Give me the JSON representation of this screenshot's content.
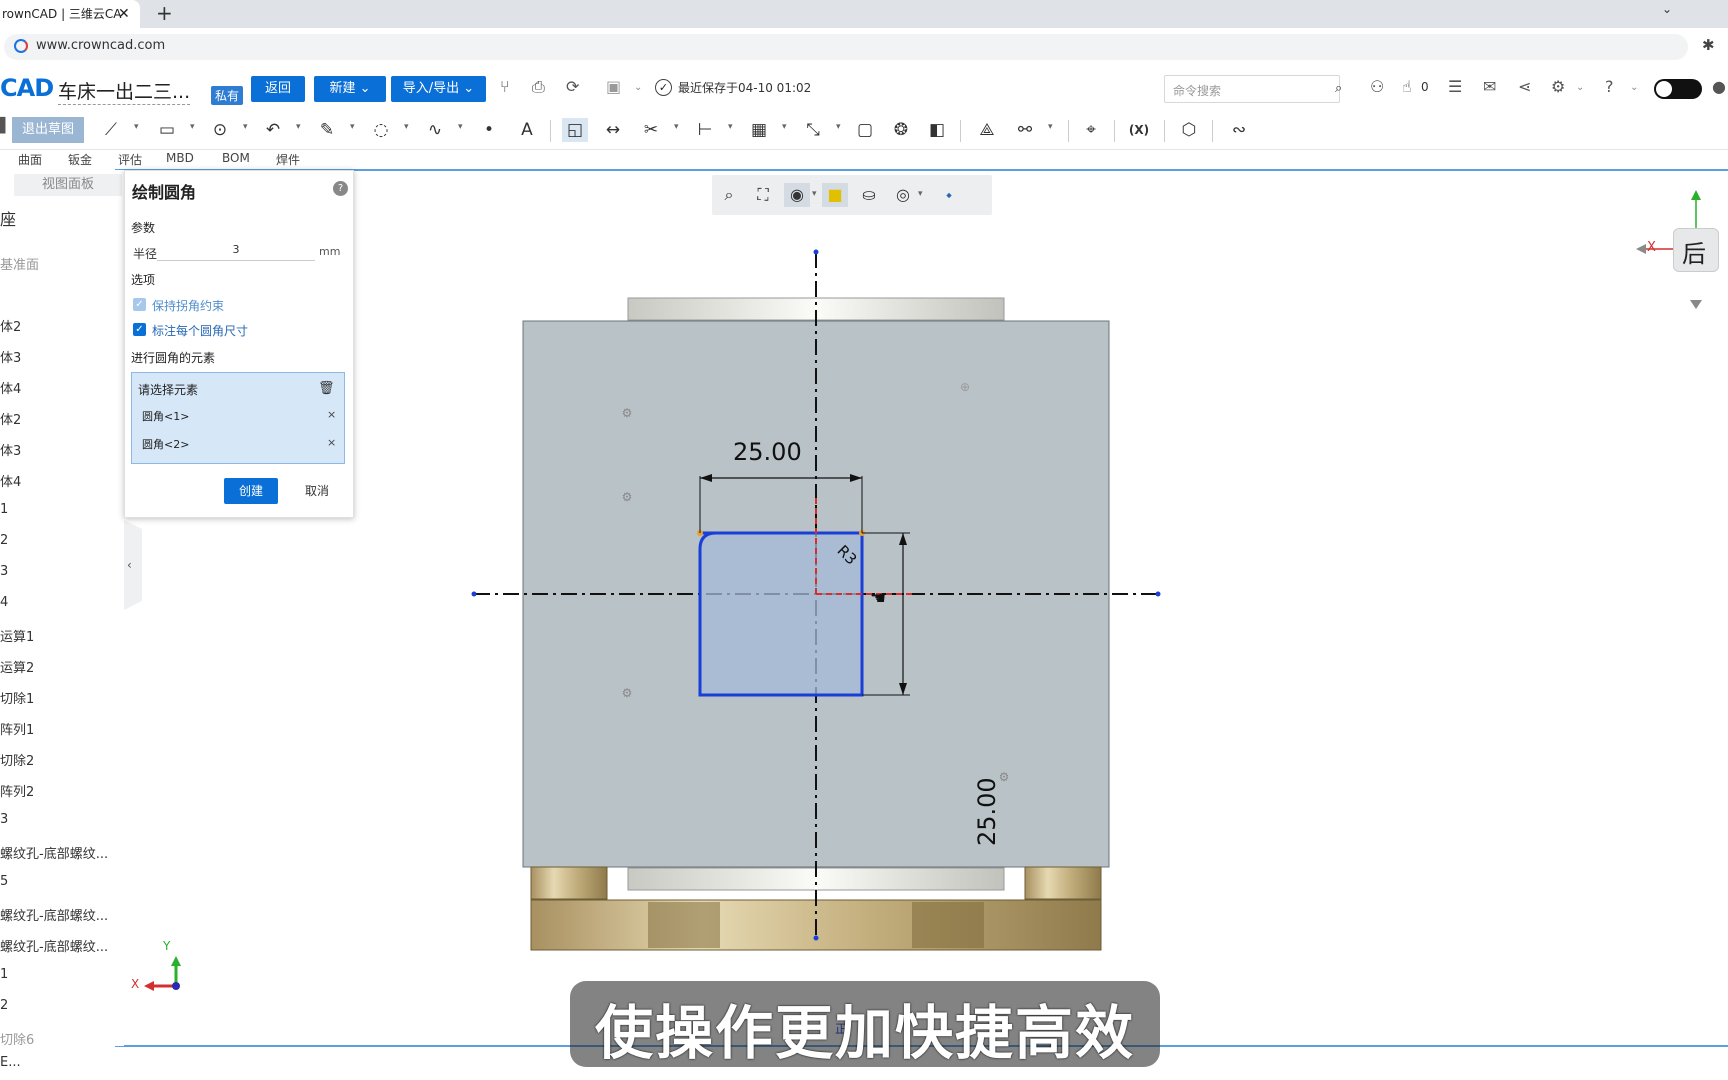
{
  "browser": {
    "tab_title": "rownCAD | 三维云CA",
    "tab_close": "✕",
    "new_tab": "+",
    "url": "www.crowncad.com"
  },
  "header": {
    "logo": "CAD",
    "doc_title": "车床一出二三...",
    "badge": "私有",
    "back_label": "返回",
    "new_label": "新建 ⌄",
    "io_label": "导入/导出 ⌄",
    "save_status": "最近保存于04-10 01:02",
    "search_placeholder": "命令搜索",
    "like_count": "0"
  },
  "toolbar": {
    "exit_sketch": "退出草图",
    "text_tool": "A",
    "fx_tool": "(X)"
  },
  "menu_tabs": [
    "曲面",
    "钣金",
    "评估",
    "MBD",
    "BOM",
    "焊件"
  ],
  "sidebar": {
    "view_panel": "视图面板",
    "items": [
      "座",
      "基准面",
      "体2",
      "体3",
      "体4",
      "体2",
      "体3",
      "体4",
      "1",
      "2",
      "3",
      "4",
      "运算1",
      "运算2",
      "切除1",
      "阵列1",
      "切除2",
      "阵列2",
      "3",
      "螺纹孔-底部螺纹...",
      "5",
      "螺纹孔-底部螺纹...",
      "螺纹孔-底部螺纹...",
      "1",
      "2",
      "切除6",
      "E..."
    ]
  },
  "fillet_panel": {
    "title": "绘制圆角",
    "help": "?",
    "params_header": "参数",
    "radius_label": "半径",
    "radius_value": "3",
    "radius_unit": "mm",
    "options_header": "选项",
    "option_keep_corner": "保持拐角约束",
    "option_dim_each": "标注每个圆角尺寸",
    "elements_header": "进行圆角的元素",
    "select_prompt": "请选择元素",
    "selected": [
      "圆角<1>",
      "圆角<2>"
    ],
    "remove": "×",
    "create_label": "创建",
    "cancel_label": "取消"
  },
  "sketch": {
    "dim_width": "25.00",
    "dim_height": "25.00",
    "fillet_label": "R3"
  },
  "triad": {
    "x": "X",
    "y": "Y"
  },
  "view_cube": {
    "face": "后",
    "axis_x": "X"
  },
  "bottom_tab": "正",
  "subtitle": "使操作更加快捷高效",
  "colors": {
    "accent": "#0a6fd6",
    "sketch_line": "#1a3fd6",
    "part_body": "#b8c1c6",
    "brass": "#c8b88a"
  }
}
